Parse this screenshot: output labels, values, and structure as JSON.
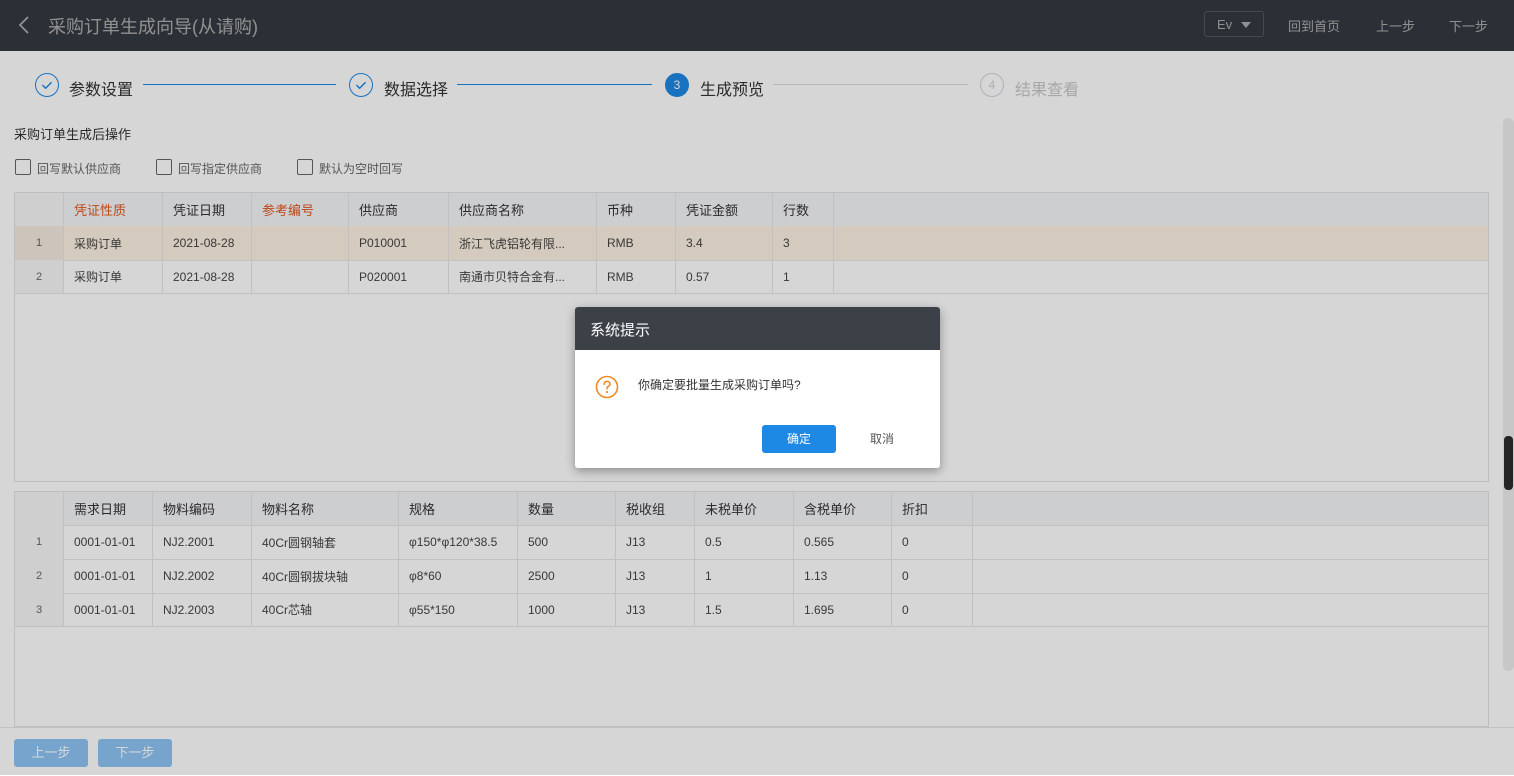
{
  "header": {
    "title": "采购订单生成向导(从请购)",
    "language": "Ev",
    "home_link": "回到首页",
    "prev_link": "上一步",
    "next_link": "下一步"
  },
  "steps": [
    {
      "index": "1",
      "label": "参数设置",
      "status": "done"
    },
    {
      "index": "2",
      "label": "数据选择",
      "status": "done"
    },
    {
      "index": "3",
      "label": "生成预览",
      "status": "current"
    },
    {
      "index": "4",
      "label": "结果查看",
      "status": "todo"
    }
  ],
  "post_actions": {
    "title": "采购订单生成后操作",
    "options": [
      {
        "label": "回写默认供应商",
        "checked": false
      },
      {
        "label": "回写指定供应商",
        "checked": false
      },
      {
        "label": "默认为空时回写",
        "checked": false
      }
    ]
  },
  "voucher_table": {
    "columns": [
      "凭证性质",
      "凭证日期",
      "参考编号",
      "供应商",
      "供应商名称",
      "币种",
      "凭证金额",
      "行数"
    ],
    "rows": [
      {
        "no": "1",
        "cells": [
          "采购订单",
          "2021-08-28",
          "",
          "P010001",
          "浙江飞虎铝轮有限...",
          "RMB",
          "3.4",
          "3"
        ]
      },
      {
        "no": "2",
        "cells": [
          "采购订单",
          "2021-08-28",
          "",
          "P020001",
          "南通市贝特合金有...",
          "RMB",
          "0.57",
          "1"
        ]
      }
    ]
  },
  "detail_table": {
    "columns": [
      "需求日期",
      "物料编码",
      "物料名称",
      "规格",
      "数量",
      "税收组",
      "未税单价",
      "含税单价",
      "折扣"
    ],
    "rows": [
      {
        "no": "1",
        "cells": [
          "0001-01-01",
          "NJ2.2001",
          "40Cr圆钢轴套",
          "φ150*φ120*38.5",
          "500",
          "J13",
          "0.5",
          "0.565",
          "0"
        ]
      },
      {
        "no": "2",
        "cells": [
          "0001-01-01",
          "NJ2.2002",
          "40Cr圆钢拔块轴",
          "φ8*60",
          "2500",
          "J13",
          "1",
          "1.13",
          "0"
        ]
      },
      {
        "no": "3",
        "cells": [
          "0001-01-01",
          "NJ2.2003",
          "40Cr芯轴",
          "φ55*150",
          "1000",
          "J13",
          "1.5",
          "1.695",
          "0"
        ]
      }
    ]
  },
  "footer": {
    "prev_button": "上一步",
    "next_button": "下一步"
  },
  "dialog": {
    "title": "系统提示",
    "message": "你确定要批量生成采购订单吗?",
    "icon": "question-circle-icon",
    "ok_label": "确定",
    "cancel_label": "取消"
  },
  "colors": {
    "header_bg": "#4d5560",
    "accent": "#1e88e5",
    "required_header": "#e2561b",
    "dialog_icon": "#f08a24"
  }
}
